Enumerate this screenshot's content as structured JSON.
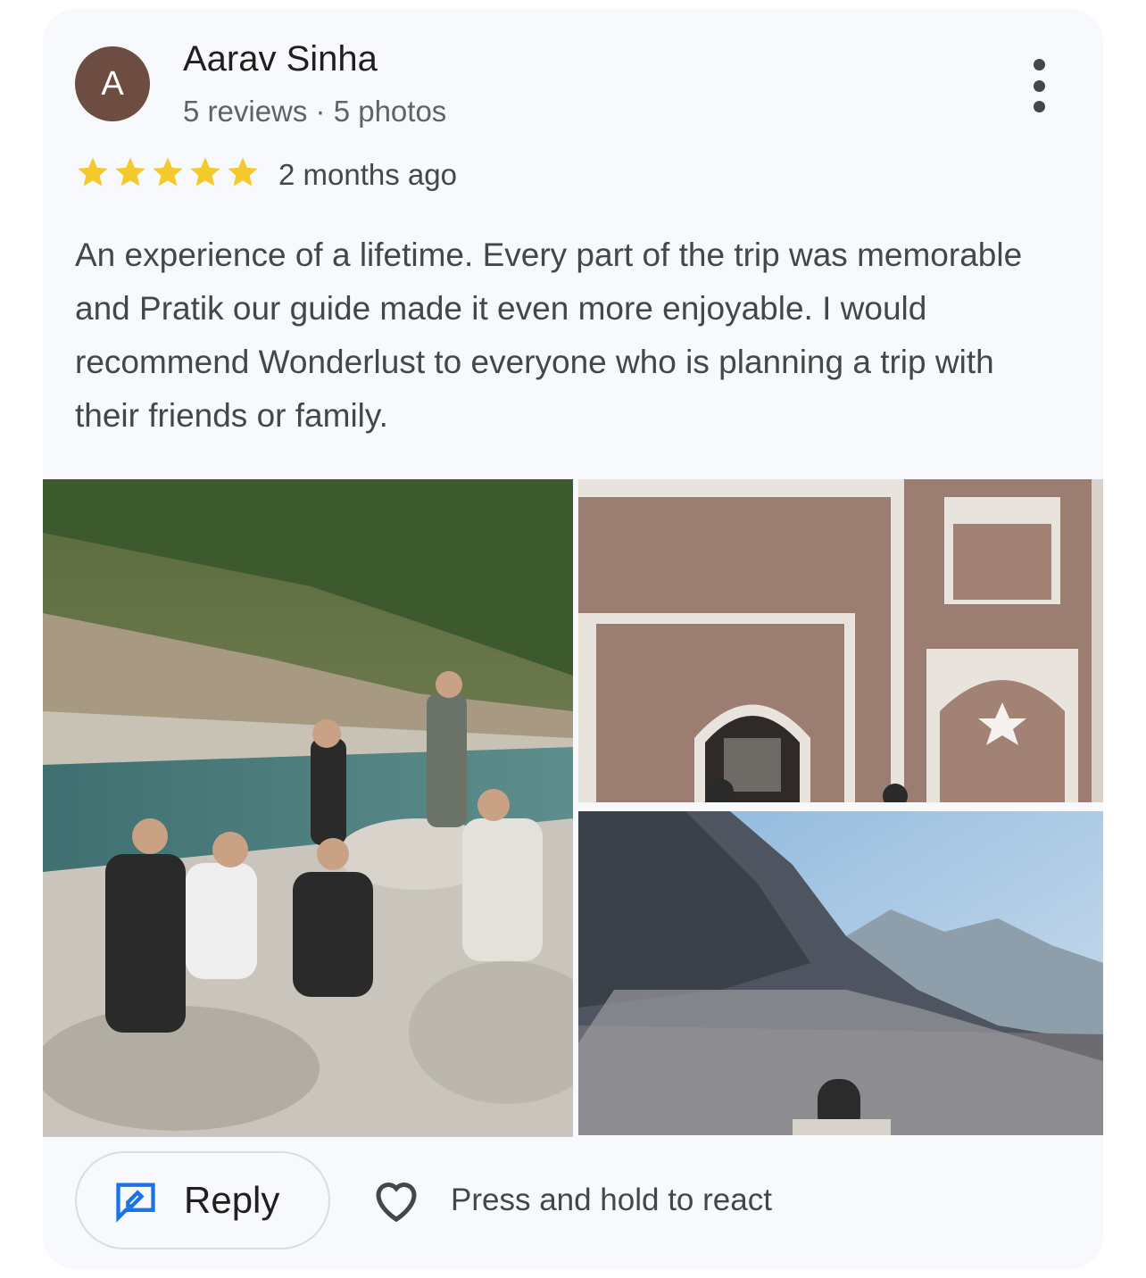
{
  "review": {
    "avatar_letter": "A",
    "author": "Aarav Sinha",
    "meta": "5 reviews · 5 photos",
    "rating": 5,
    "date": "2 months ago",
    "text": "An experience of a lifetime. Every part of the trip was memorable and Pratik our guide made it even more enjoyable. I would recommend Wonderlust to everyone who is planning a trip with their friends or family."
  },
  "photos": [
    {
      "name": "photo-river-group"
    },
    {
      "name": "photo-building-facade"
    },
    {
      "name": "photo-snowy-mountains"
    }
  ],
  "actions": {
    "reply_label": "Reply",
    "react_hint": "Press and hold to react"
  },
  "colors": {
    "star": "#f4c92b",
    "reply_icon": "#1a73e8",
    "avatar": "#6d4c41"
  }
}
